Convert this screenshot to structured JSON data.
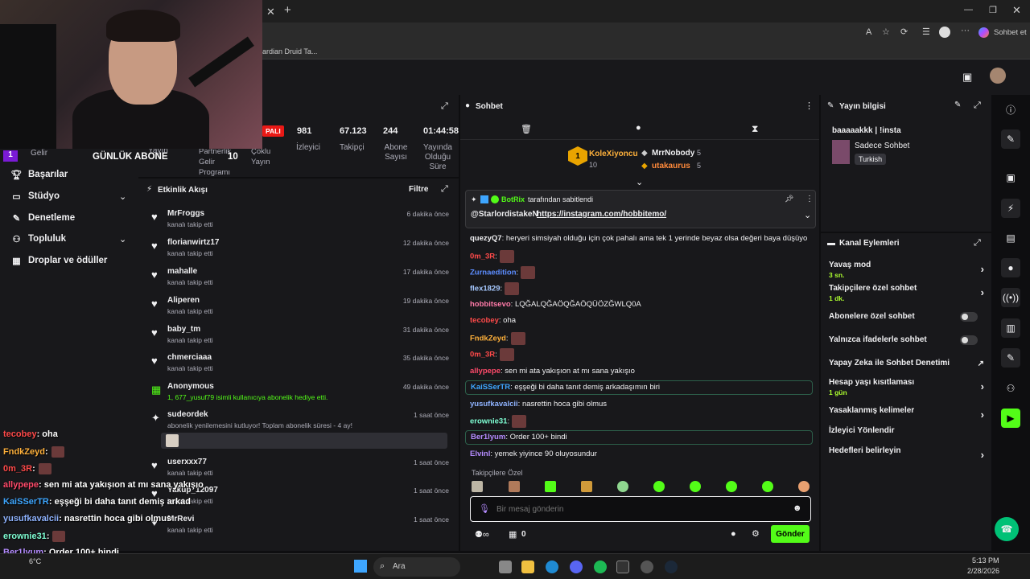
{
  "browser": {
    "bookmark_partial": "ardian Druid Ta...",
    "copilot_label": "Sohbet et"
  },
  "overlay_top": {
    "gelir_num": "1",
    "gelir_label": "Gelir",
    "gunluk_abone": "GÜNLÜK ABONE",
    "yayin": "Yayın",
    "partner_label": "Partnerlik Gelir Programı",
    "partner_count": "10",
    "coklu": "Çoklu Yayın"
  },
  "nav": {
    "items": [
      {
        "label": "Başarılar",
        "icon": "trophy-icon"
      },
      {
        "label": "Stüdyo",
        "icon": "camera-icon",
        "chevron": true
      },
      {
        "label": "Denetleme",
        "icon": "wrench-icon"
      },
      {
        "label": "Topluluk",
        "icon": "community-icon",
        "chevron": true
      },
      {
        "label": "Droplar ve ödüller",
        "icon": "gift-icon"
      }
    ]
  },
  "stats": {
    "live_badge": "PALI",
    "items": [
      {
        "value": "981",
        "label": "İzleyici"
      },
      {
        "value": "67.123",
        "label": "Takipçi"
      },
      {
        "value": "244",
        "label": "Abone Sayısı"
      },
      {
        "value": "01:44:58",
        "label": "Yayında Olduğu Süre"
      }
    ]
  },
  "feed": {
    "title": "Etkinlik Akışı",
    "filter": "Filtre",
    "rows": [
      {
        "name": "MrFroggs",
        "sub": "kanalı takip etti",
        "time": "6 dakika önce",
        "icon": "heart-icon"
      },
      {
        "name": "florianwirtz17",
        "sub": "kanalı takip etti",
        "time": "12 dakika önce",
        "icon": "heart-icon"
      },
      {
        "name": "mahalle",
        "sub": "kanalı takip etti",
        "time": "17 dakika önce",
        "icon": "heart-icon"
      },
      {
        "name": "Aliperen",
        "sub": "kanalı takip etti",
        "time": "19 dakika önce",
        "icon": "heart-icon"
      },
      {
        "name": "baby_tm",
        "sub": "kanalı takip etti",
        "time": "31 dakika önce",
        "icon": "heart-icon"
      },
      {
        "name": "chmerciaaa",
        "sub": "kanalı takip etti",
        "time": "35 dakika önce",
        "icon": "heart-icon"
      },
      {
        "name": "Anonymous",
        "sub": "1, 677_yusuf79 isimli kullanıcıya abonelik hediye etti.",
        "time": "49 dakika önce",
        "icon": "gift-icon"
      },
      {
        "name": "sudeordek",
        "sub": "abonelik yenilemesini kutluyor! Toplam abonelik süresi - 4 ay!",
        "time": "1 saat önce",
        "icon": "star-icon"
      },
      {
        "name": "userxxx77",
        "sub": "kanalı takip etti",
        "time": "1 saat önce",
        "icon": "heart-icon"
      },
      {
        "name": "Yakup_12097",
        "sub": "kanalı takip etti",
        "time": "1 saat önce",
        "icon": "heart-icon"
      },
      {
        "name": "MrRevi",
        "sub": "kanalı takip etti",
        "time": "1 saat önce",
        "icon": "heart-icon"
      }
    ]
  },
  "chat": {
    "title": "Sohbet",
    "top_gifters": [
      {
        "name": "KoleXiyoncu",
        "count": "10"
      },
      {
        "name": "MrrNobody",
        "count": "5"
      },
      {
        "name": "utakaurus",
        "count": "5"
      }
    ],
    "pinned": {
      "by": "BotRix",
      "by_suffix": "tarafından sabitlendi",
      "mention": "@StarlordistakeN",
      "link": "https://instagram.com/hobbitemo/"
    },
    "messages": [
      {
        "user": "quezyQ7",
        "color": "#efeff1",
        "text": ": heryeri simsiyah olduğu için çok pahalı ama tek 1 yerinde beyaz olsa değeri baya düşüyo",
        "emote": false
      },
      {
        "user": "0m_3R",
        "color": "#ff4a4a",
        "text": ":",
        "emote": true
      },
      {
        "user": "Zurnaedition",
        "color": "#5c8dff",
        "text": ":",
        "emote": true
      },
      {
        "user": "flex1829",
        "color": "#a6c8ff",
        "text": ":",
        "emote": true
      },
      {
        "user": "hobbitsevo",
        "color": "#ff7aa8",
        "text": ": LQĞALQĞAÖQĞAÖQÜÖZĞWLQ0A",
        "emote": false
      },
      {
        "user": "tecobey",
        "color": "#ff4a4a",
        "text": ": oha",
        "emote": false
      },
      {
        "user": "FndkZeyd",
        "color": "#ffb13b",
        "text": ":",
        "emote": true
      },
      {
        "user": "0m_3R",
        "color": "#ff4a4a",
        "text": ":",
        "emote": true
      },
      {
        "user": "allypepe",
        "color": "#ff4a6a",
        "text": ": sen mi ata yakışıon at mı sana yakışıo",
        "emote": false
      },
      {
        "user": "KaiSSerTR",
        "color": "#3ea6ff",
        "text": ": eşşeği bi daha tanıt demiş arkadaşımın biri",
        "emote": false
      },
      {
        "user": "yusufkavalcii",
        "color": "#8fb3ff",
        "text": ": nasrettin hoca gibi olmus",
        "emote": false
      },
      {
        "user": "erownie31",
        "color": "#7fffd4",
        "text": ":",
        "emote": true
      },
      {
        "user": "Ber1lyum",
        "color": "#b58cff",
        "text": ": Order 100+ bindi",
        "emote": false
      },
      {
        "user": "Elvinl",
        "color": "#b58cff",
        "text": ": yemek yiyince 90 oluyosundur",
        "emote": false
      }
    ],
    "followers_only": "Takipçilere Özel",
    "placeholder": "Bir mesaj gönderin",
    "points": "0",
    "send": "Gönder"
  },
  "info": {
    "title": "Yayın bilgisi",
    "stream_title": "baaaaakkk | !insta",
    "category": "Sadece Sohbet",
    "language": "Turkish",
    "actions_title": "Kanal Eylemleri",
    "actions": [
      {
        "label": "Yavaş mod",
        "sub": "3 sn.",
        "kind": "chevron"
      },
      {
        "label": "Takipçilere özel sohbet",
        "sub": "1 dk.",
        "kind": "chevron"
      },
      {
        "label": "Abonelere özel sohbet",
        "sub": "",
        "kind": "toggle"
      },
      {
        "label": "Yalnızca ifadelerle sohbet",
        "sub": "",
        "kind": "toggle"
      },
      {
        "label": "Yapay Zeka ile Sohbet Denetimi",
        "sub": "",
        "kind": "external"
      },
      {
        "label": "Hesap yaşı kısıtlaması",
        "sub": "1 gün",
        "kind": "chevron"
      },
      {
        "label": "Yasaklanmış kelimeler",
        "sub": "",
        "kind": "chevron"
      },
      {
        "label": "İzleyici Yönlendir",
        "sub": "",
        "kind": "none"
      },
      {
        "label": "Hedefleri belirleyin",
        "sub": "",
        "kind": "chevron"
      }
    ]
  },
  "overlay_chat": [
    {
      "user": "tecobey",
      "color": "#ff4a4a",
      "text": ": oha",
      "emote": false
    },
    {
      "user": "FndkZeyd",
      "color": "#ffb13b",
      "text": ":",
      "emote": true
    },
    {
      "user": "0m_3R",
      "color": "#ff4a4a",
      "text": ":",
      "emote": true
    },
    {
      "user": "allypepe",
      "color": "#ff4a6a",
      "text": ": sen mi ata yakışıon at mı sana yakışıo",
      "emote": false
    },
    {
      "user": "KaiSSerTR",
      "color": "#3ea6ff",
      "text": ": eşşeği bi daha tanıt demiş arkad",
      "emote": false
    },
    {
      "user": "yusufkavalcii",
      "color": "#8fb3ff",
      "text": ": nasrettin hoca gibi olmus",
      "emote": false
    },
    {
      "user": "erownie31",
      "color": "#7fffd4",
      "text": ":",
      "emote": true
    },
    {
      "user": "Ber1lyum",
      "color": "#b58cff",
      "text": ": Order 100+ bindi",
      "emote": false
    },
    {
      "user": "Elvinl",
      "color": "#b58cff",
      "text": ": yemek yiyince 90 oluyosundur",
      "emote": false
    }
  ],
  "taskbar": {
    "weather": "6°C",
    "search": "Ara",
    "time": "5:13 PM",
    "date": "2/28/2026"
  },
  "colors": {
    "accent": "#53fc18",
    "panel": "#18181b",
    "bg": "#0e0e10"
  }
}
